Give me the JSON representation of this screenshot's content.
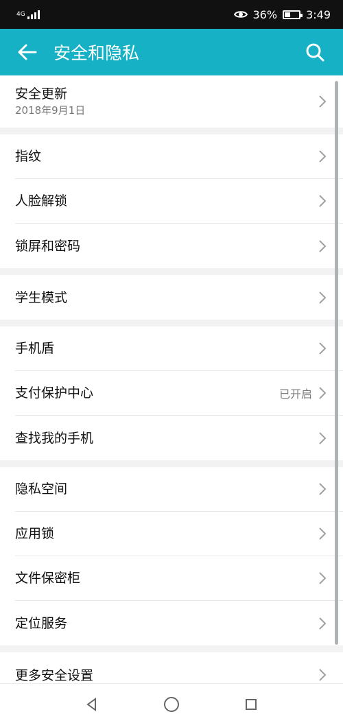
{
  "statusbar": {
    "network": "4G",
    "eye_comfort_icon": "eye-icon",
    "battery": "36%",
    "time": "3:49"
  },
  "appbar": {
    "title": "安全和隐私",
    "back_icon": "arrow-left-icon",
    "search_icon": "search-icon"
  },
  "groups": [
    {
      "items": [
        {
          "label": "安全更新",
          "sublabel": "2018年9月1日",
          "status": ""
        }
      ]
    },
    {
      "items": [
        {
          "label": "指纹",
          "status": ""
        },
        {
          "label": "人脸解锁",
          "status": ""
        },
        {
          "label": "锁屏和密码",
          "status": ""
        }
      ]
    },
    {
      "items": [
        {
          "label": "学生模式",
          "status": ""
        }
      ]
    },
    {
      "items": [
        {
          "label": "手机盾",
          "status": ""
        },
        {
          "label": "支付保护中心",
          "status": "已开启"
        },
        {
          "label": "查找我的手机",
          "status": ""
        }
      ]
    },
    {
      "items": [
        {
          "label": "隐私空间",
          "status": ""
        },
        {
          "label": "应用锁",
          "status": ""
        },
        {
          "label": "文件保密柜",
          "status": ""
        },
        {
          "label": "定位服务",
          "status": ""
        }
      ]
    },
    {
      "items": [
        {
          "label": "更多安全设置",
          "status": ""
        }
      ]
    }
  ],
  "navigation": {
    "back": "triangle-back-icon",
    "home": "circle-home-icon",
    "recent": "square-recent-icon"
  }
}
